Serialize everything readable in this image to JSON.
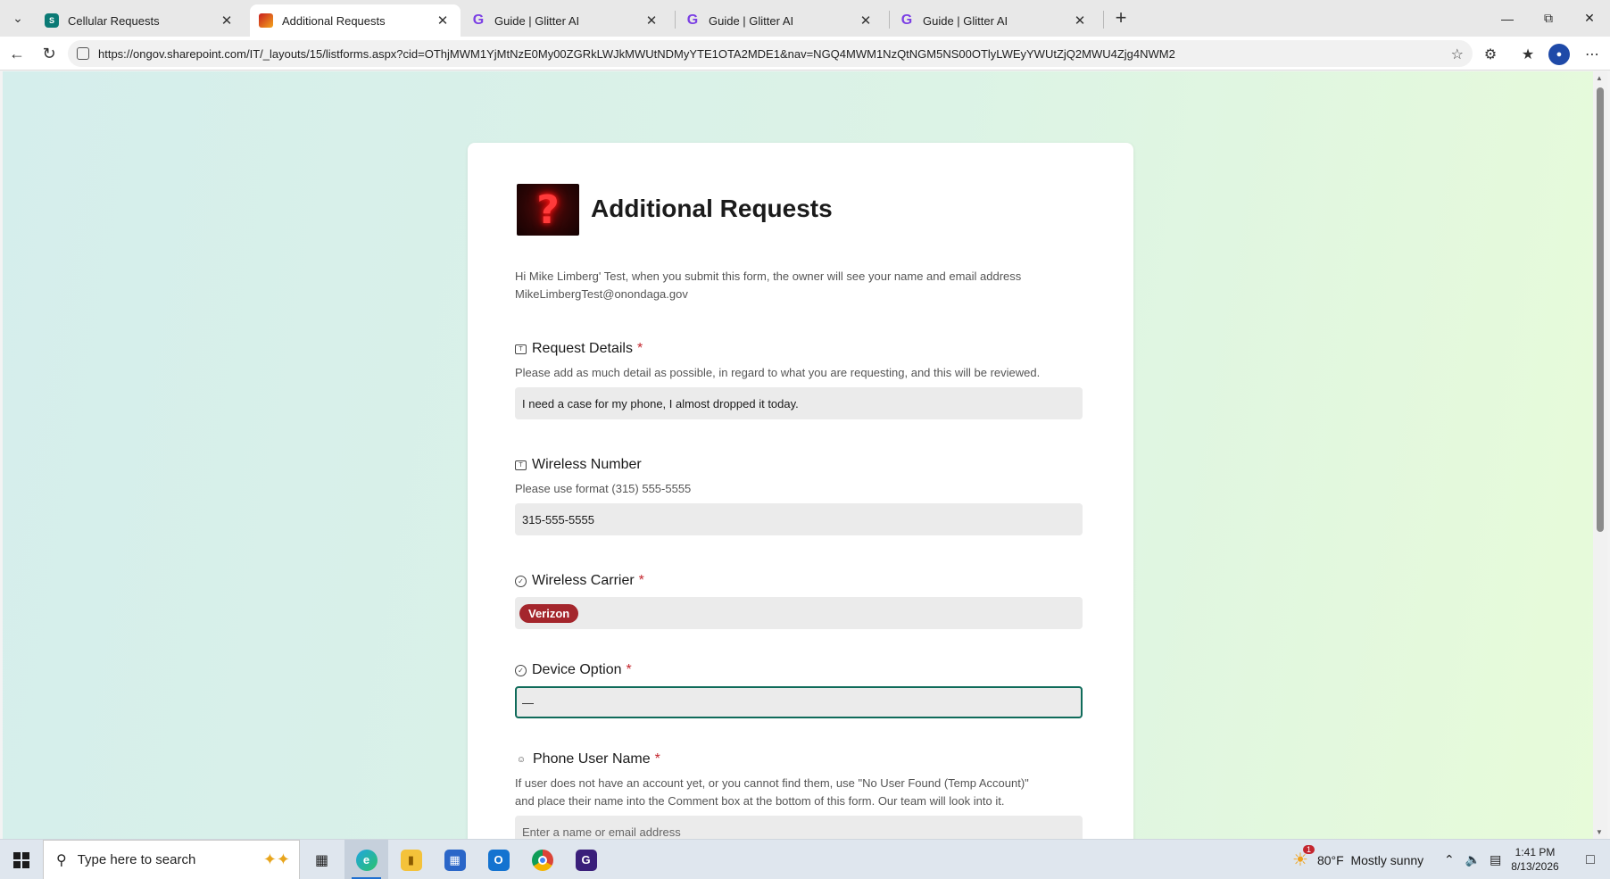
{
  "browser": {
    "tabs": [
      {
        "label": "Cellular Requests",
        "icon": "sharepoint-icon",
        "active": false
      },
      {
        "label": "Additional Requests",
        "icon": "lists-icon",
        "active": true
      },
      {
        "label": "Guide | Glitter AI",
        "icon": "glitter-icon",
        "active": false
      },
      {
        "label": "Guide | Glitter AI",
        "icon": "glitter-icon",
        "active": false
      },
      {
        "label": "Guide | Glitter AI",
        "icon": "glitter-icon",
        "active": false
      }
    ],
    "url": "https://ongov.sharepoint.com/IT/_layouts/15/listforms.aspx?cid=OThjMWM1YjMtNzE0My00ZGRkLWJkMWUtNDMyYTE1OTA2MDE1&nav=NGQ4MWM1NzQtNGM5NS00OTlyLWEyYWUtZjQ2MWU4Zjg4NWM2"
  },
  "form": {
    "title": "Additional Requests",
    "intro_line1": "Hi Mike Limberg' Test, when you submit this form, the owner will see your name and email address",
    "intro_line2": "MikeLimbergTest@onondaga.gov",
    "required_marker": "*",
    "questions": {
      "request_details": {
        "label": "Request Details",
        "description": "Please add as much detail as possible, in regard to what you are requesting, and this will be reviewed.",
        "value": "I need a case for my phone, I almost dropped it today."
      },
      "wireless_number": {
        "label": "Wireless Number",
        "description": "Please use format (315) 555-5555",
        "value": "315-555-5555"
      },
      "wireless_carrier": {
        "label": "Wireless Carrier",
        "value": "Verizon"
      },
      "device_option": {
        "label": "Device Option",
        "value": "—"
      },
      "phone_user_name": {
        "label": "Phone User Name",
        "description_line1": "If user does not have an account yet, or you cannot find them, use \"No User Found (Temp Account)\"",
        "description_line2": "and place their name into the Comment box at the bottom of this form. Our team will look into it.",
        "placeholder": "Enter a name or email address"
      }
    },
    "colors": {
      "required": "#c4262e",
      "pill": "#a4262c",
      "focus_border": "#0f6b5a"
    }
  },
  "taskbar": {
    "search_placeholder": "Type here to search",
    "weather_badge": "1",
    "weather": "80°F  Mostly sunny",
    "time": "1:41 PM",
    "date": "8/13/2026"
  }
}
